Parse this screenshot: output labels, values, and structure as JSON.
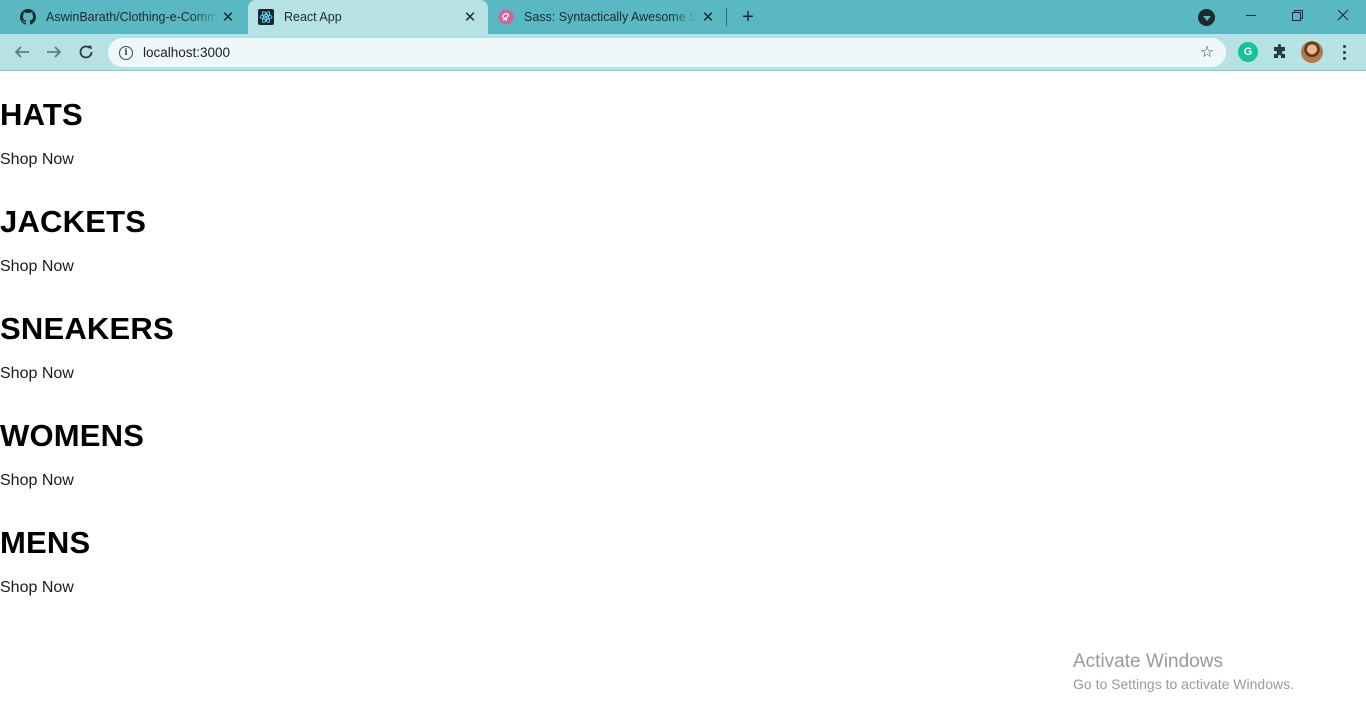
{
  "browser": {
    "tabs": [
      {
        "title": "AswinBarath/Clothing-e-Commerce",
        "icon": "github-icon"
      },
      {
        "title": "React App",
        "icon": "react-icon",
        "active": true
      },
      {
        "title": "Sass: Syntactically Awesome Style Sheets",
        "icon": "sass-icon"
      }
    ],
    "new_tab_glyph": "+",
    "address": "localhost:3000"
  },
  "page": {
    "categories": [
      {
        "title": "HATS",
        "link": "Shop Now"
      },
      {
        "title": "JACKETS",
        "link": "Shop Now"
      },
      {
        "title": "SNEAKERS",
        "link": "Shop Now"
      },
      {
        "title": "WOMENS",
        "link": "Shop Now"
      },
      {
        "title": "MENS",
        "link": "Shop Now"
      }
    ]
  },
  "watermark": {
    "title": "Activate Windows",
    "subtitle": "Go to Settings to activate Windows."
  },
  "colors": {
    "tabstrip": "#5ab8c2",
    "toolbar": "#b6e2e6",
    "grammarly": "#15c39a"
  }
}
